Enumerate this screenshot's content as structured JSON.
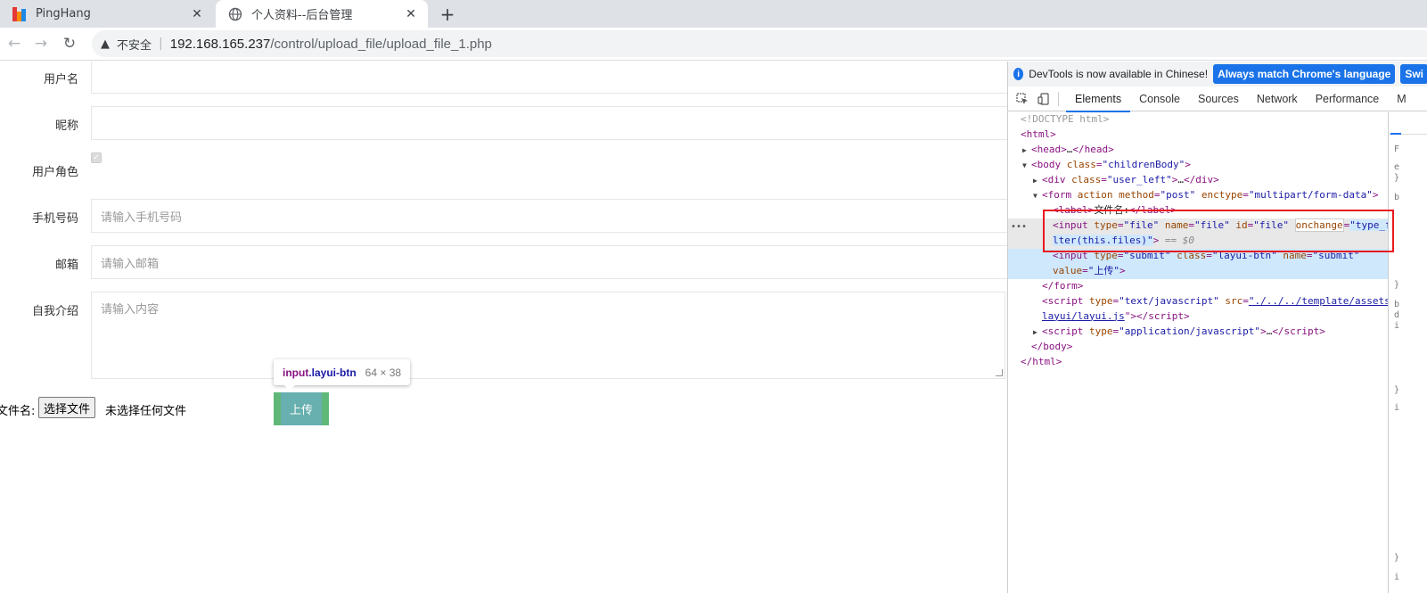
{
  "browser": {
    "tabs": [
      {
        "title": "PingHang",
        "active": false
      },
      {
        "title": "个人资料--后台管理",
        "active": true
      }
    ],
    "new_tab": "+",
    "address": {
      "warning": "不安全",
      "separator": "|",
      "host": "192.168.165.237",
      "path": "/control/upload_file/upload_file_1.php"
    }
  },
  "form": {
    "username_label": "用户名",
    "nickname_label": "昵称",
    "role_label": "用户角色",
    "phone_label": "手机号码",
    "phone_placeholder": "请输入手机号码",
    "email_label": "邮箱",
    "email_placeholder": "请输入邮箱",
    "intro_label": "自我介绍",
    "intro_placeholder": "请输入内容",
    "file_label": "文件名:",
    "choose_file": "选择文件",
    "no_file": "未选择任何文件",
    "upload_button": "上传"
  },
  "tooltip": {
    "tag": "input",
    "class": ".layui-btn",
    "size": "64 × 38"
  },
  "devtools": {
    "info_text": "DevTools is now available in Chinese!",
    "match_button": "Always match Chrome's language",
    "switch_button": "Swi",
    "tabs": [
      "Elements",
      "Console",
      "Sources",
      "Network",
      "Performance",
      "M"
    ],
    "active_tab": "Elements",
    "side_fragments": [
      "F",
      "e",
      "}",
      "b",
      "}",
      "b",
      "d",
      "i",
      "}",
      "i",
      "}",
      "i"
    ]
  },
  "colors": {
    "upload_button": "#5fb878",
    "devtools_accent": "#1a73e8",
    "highlight_box": "#e8191d",
    "tag": "#881280",
    "attr": "#994500",
    "value": "#1a1aa6"
  }
}
